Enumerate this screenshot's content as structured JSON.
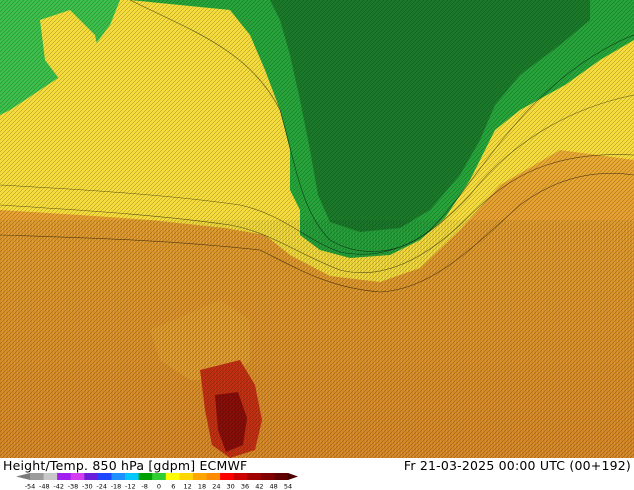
{
  "title": {
    "left": "Height/Temp. 850 hPa [gdpm] ECMWF",
    "right": "Fr 21-03-2025 00:00 UTC (00+192)"
  },
  "colorbar": {
    "ticks": [
      "-54",
      "-48",
      "-42",
      "-38",
      "-30",
      "-24",
      "-18",
      "-12",
      "-8",
      "0",
      "6",
      "12",
      "18",
      "24",
      "30",
      "36",
      "42",
      "48",
      "54"
    ],
    "colors": [
      "#9b9b9b",
      "#c8c8c8",
      "#a020f0",
      "#d43cf0",
      "#6a1fd8",
      "#1e46ff",
      "#1e90ff",
      "#00c8ff",
      "#00a000",
      "#32cd32",
      "#ffff00",
      "#ffd700",
      "#ffa500",
      "#ff8c00",
      "#ff0000",
      "#cc0000",
      "#a00000",
      "#800000",
      "#600000"
    ]
  },
  "map_colors": {
    "green_dark": "#1a7a2a",
    "green": "#26a43a",
    "green_light": "#3cbf4a",
    "yellow": "#f5dc3c",
    "yellow_orange": "#f0c43a",
    "orange": "#e6a030",
    "orange_dark": "#dc8c28",
    "red": "#c83214",
    "dark_red": "#8c0f0a"
  }
}
